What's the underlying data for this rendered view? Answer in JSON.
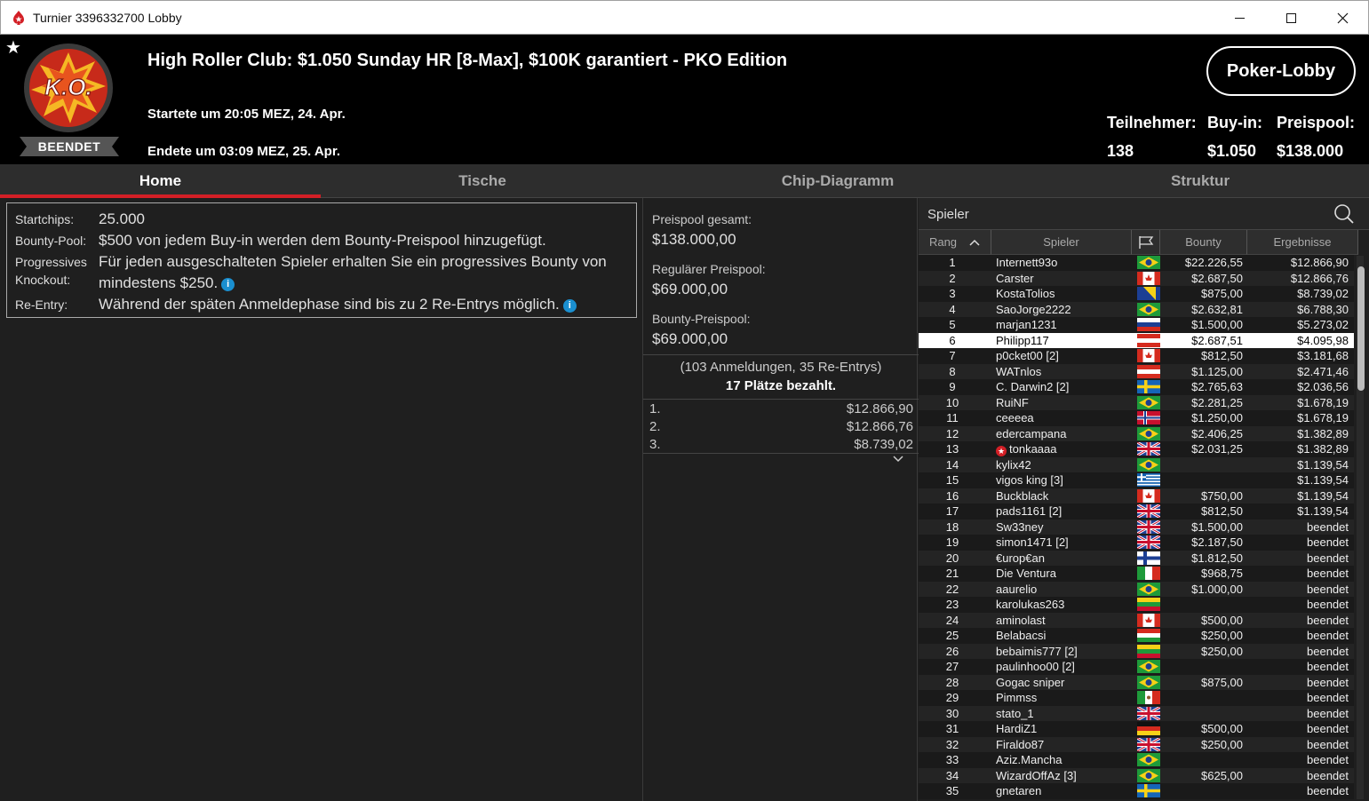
{
  "window": {
    "title": "Turnier 3396332700 Lobby"
  },
  "header": {
    "status": "BEENDET",
    "tournament_name": "High Roller Club: $1.050 Sunday HR [8-Max], $100K garantiert - PKO Edition",
    "started": "Startete um 20:05 MEZ, 24. Apr.",
    "ended": "Endete um 03:09 MEZ, 25. Apr.",
    "lobby_button": "Poker-Lobby",
    "badge_text": "K.O.",
    "stats": {
      "players_label": "Teilnehmer:",
      "players_value": "138",
      "buyin_label": "Buy-in:",
      "buyin_value": "$1.050",
      "prizepool_label": "Preispool:",
      "prizepool_value": "$138.000"
    }
  },
  "tabs": [
    "Home",
    "Tische",
    "Chip-Diagramm",
    "Struktur"
  ],
  "info": {
    "startchips_label": "Startchips:",
    "startchips_value": "25.000",
    "bounty_label": "Bounty-Pool:",
    "bounty_value": "$500 von jedem Buy-in werden dem Bounty-Preispool hinzugefügt.",
    "pko_label1": "Progressives",
    "pko_label2": "Knockout:",
    "pko_value1": "Für jeden ausgeschalteten Spieler erhalten Sie ein progressives Bounty von",
    "pko_value2": "mindestens $250.",
    "reentry_label": "Re-Entry:",
    "reentry_value": "Während der späten Anmeldephase sind bis zu 2 Re-Entrys möglich.",
    "info_glyph": "i"
  },
  "prizepool": {
    "total_label": "Preispool gesamt:",
    "total_value": "$138.000,00",
    "regular_label": "Regulärer Preispool:",
    "regular_value": "$69.000,00",
    "bounty_label": "Bounty-Preispool:",
    "bounty_value": "$69.000,00",
    "registrations": "(103 Anmeldungen, 35 Re-Entrys)",
    "paid": "17 Plätze bezahlt.",
    "payouts": [
      {
        "rank": "1.",
        "amount": "$12.866,90"
      },
      {
        "rank": "2.",
        "amount": "$12.866,76"
      },
      {
        "rank": "3.",
        "amount": "$8.739,02"
      }
    ]
  },
  "players_panel": {
    "search_label": "Spieler",
    "headers": {
      "rank": "Rang",
      "player": "Spieler",
      "bounty": "Bounty",
      "result": "Ergebnisse"
    },
    "rows": [
      {
        "rank": "1",
        "name": "Internett93o",
        "flag": "br",
        "bounty": "$22.226,55",
        "result": "$12.866,90"
      },
      {
        "rank": "2",
        "name": "Carster",
        "flag": "ca",
        "bounty": "$2.687,50",
        "result": "$12.866,76"
      },
      {
        "rank": "3",
        "name": "KostaTolios",
        "flag": "ba",
        "bounty": "$875,00",
        "result": "$8.739,02"
      },
      {
        "rank": "4",
        "name": "SaoJorge2222",
        "flag": "br",
        "bounty": "$2.632,81",
        "result": "$6.788,30"
      },
      {
        "rank": "5",
        "name": "marjan1231",
        "flag": "si",
        "bounty": "$1.500,00",
        "result": "$5.273,02"
      },
      {
        "rank": "6",
        "name": "Philipp117",
        "flag": "at",
        "bounty": "$2.687,51",
        "result": "$4.095,98"
      },
      {
        "rank": "7",
        "name": "p0cket00 [2]",
        "flag": "ca",
        "bounty": "$812,50",
        "result": "$3.181,68"
      },
      {
        "rank": "8",
        "name": "WATnlos",
        "flag": "at",
        "bounty": "$1.125,00",
        "result": "$2.471,46"
      },
      {
        "rank": "9",
        "name": "C. Darwin2 [2]",
        "flag": "se",
        "bounty": "$2.765,63",
        "result": "$2.036,56"
      },
      {
        "rank": "10",
        "name": "RuiNF",
        "flag": "br",
        "bounty": "$2.281,25",
        "result": "$1.678,19"
      },
      {
        "rank": "11",
        "name": "ceeeea",
        "flag": "no",
        "bounty": "$1.250,00",
        "result": "$1.678,19"
      },
      {
        "rank": "12",
        "name": "edercampana",
        "flag": "br",
        "bounty": "$2.406,25",
        "result": "$1.382,89"
      },
      {
        "rank": "13",
        "name": "tonkaaaa",
        "flag": "gb",
        "bounty": "$2.031,25",
        "result": "$1.382,89",
        "star": true
      },
      {
        "rank": "14",
        "name": "kylix42",
        "flag": "br",
        "bounty": "",
        "result": "$1.139,54"
      },
      {
        "rank": "15",
        "name": "vigos king [3]",
        "flag": "gr",
        "bounty": "",
        "result": "$1.139,54"
      },
      {
        "rank": "16",
        "name": "Buckblack",
        "flag": "ca",
        "bounty": "$750,00",
        "result": "$1.139,54"
      },
      {
        "rank": "17",
        "name": "pads1161 [2]",
        "flag": "gb",
        "bounty": "$812,50",
        "result": "$1.139,54"
      },
      {
        "rank": "18",
        "name": "Sw33ney",
        "flag": "gb",
        "bounty": "$1.500,00",
        "result": "beendet"
      },
      {
        "rank": "19",
        "name": "simon1471 [2]",
        "flag": "gb",
        "bounty": "$2.187,50",
        "result": "beendet"
      },
      {
        "rank": "20",
        "name": "€urop€an",
        "flag": "fi",
        "bounty": "$1.812,50",
        "result": "beendet"
      },
      {
        "rank": "21",
        "name": "Die Ventura",
        "flag": "it",
        "bounty": "$968,75",
        "result": "beendet"
      },
      {
        "rank": "22",
        "name": "aaurelio",
        "flag": "br",
        "bounty": "$1.000,00",
        "result": "beendet"
      },
      {
        "rank": "23",
        "name": "karolukas263",
        "flag": "lt",
        "bounty": "",
        "result": "beendet"
      },
      {
        "rank": "24",
        "name": "aminolast",
        "flag": "ca",
        "bounty": "$500,00",
        "result": "beendet"
      },
      {
        "rank": "25",
        "name": "Belabacsi",
        "flag": "hu",
        "bounty": "$250,00",
        "result": "beendet"
      },
      {
        "rank": "26",
        "name": "bebaimis777 [2]",
        "flag": "lt",
        "bounty": "$250,00",
        "result": "beendet"
      },
      {
        "rank": "27",
        "name": "paulinhoo00 [2]",
        "flag": "br",
        "bounty": "",
        "result": "beendet"
      },
      {
        "rank": "28",
        "name": "Gogac sniper",
        "flag": "br",
        "bounty": "$875,00",
        "result": "beendet"
      },
      {
        "rank": "29",
        "name": "Pimmss",
        "flag": "mx",
        "bounty": "",
        "result": "beendet"
      },
      {
        "rank": "30",
        "name": "stato_1",
        "flag": "gb",
        "bounty": "",
        "result": "beendet"
      },
      {
        "rank": "31",
        "name": "HardiZ1",
        "flag": "de",
        "bounty": "$500,00",
        "result": "beendet"
      },
      {
        "rank": "32",
        "name": "Firaldo87",
        "flag": "gb",
        "bounty": "$250,00",
        "result": "beendet"
      },
      {
        "rank": "33",
        "name": "Aziz.Mancha",
        "flag": "br",
        "bounty": "",
        "result": "beendet"
      },
      {
        "rank": "34",
        "name": "WizardOffAz [3]",
        "flag": "br",
        "bounty": "$625,00",
        "result": "beendet"
      },
      {
        "rank": "35",
        "name": "gnetaren",
        "flag": "se",
        "bounty": "",
        "result": "beendet"
      }
    ],
    "selected_rank": "6"
  }
}
